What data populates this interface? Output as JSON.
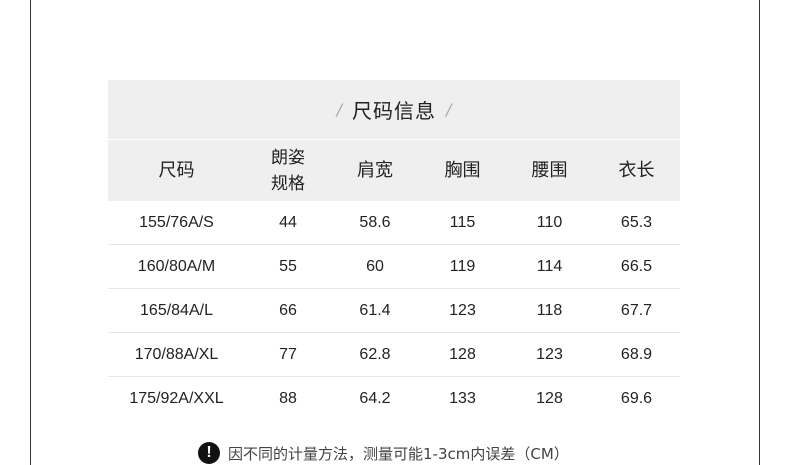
{
  "title": "尺码信息",
  "title_decor": {
    "left": "/",
    "right": "/"
  },
  "headers": [
    "尺码",
    "朗姿\n规格",
    "肩宽",
    "胸围",
    "腰围",
    "衣长"
  ],
  "rows": [
    [
      "155/76A/S",
      "44",
      "58.6",
      "115",
      "110",
      "65.3"
    ],
    [
      "160/80A/M",
      "55",
      "60",
      "119",
      "114",
      "66.5"
    ],
    [
      "165/84A/L",
      "66",
      "61.4",
      "123",
      "118",
      "67.7"
    ],
    [
      "170/88A/XL",
      "77",
      "62.8",
      "128",
      "123",
      "68.9"
    ],
    [
      "175/92A/XXL",
      "88",
      "64.2",
      "133",
      "128",
      "69.6"
    ]
  ],
  "footnote": {
    "icon": "exclamation-icon",
    "glyph": "!",
    "text": "因不同的计量方法，测量可能1-3cm内误差（CM）"
  }
}
